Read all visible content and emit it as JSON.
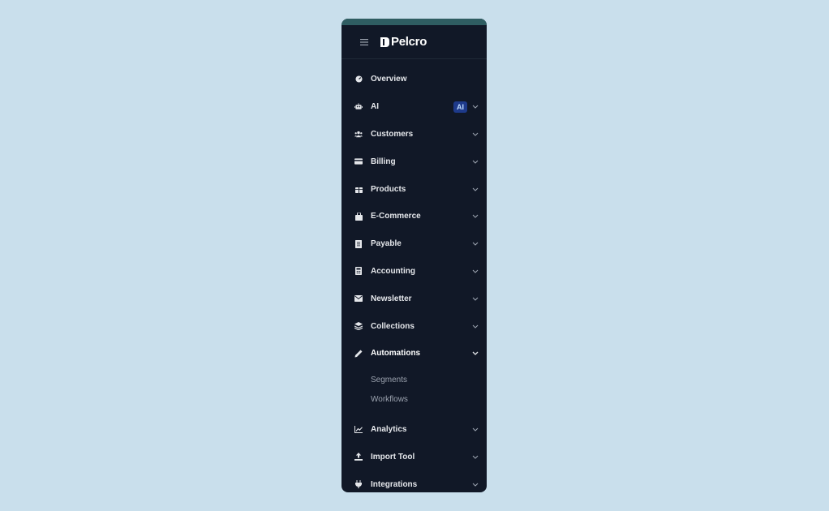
{
  "brand": {
    "name": "Pelcro"
  },
  "nav": {
    "overview": "Overview",
    "ai": "AI",
    "ai_badge": "AI",
    "customers": "Customers",
    "billing": "Billing",
    "products": "Products",
    "ecommerce": "E-Commerce",
    "payable": "Payable",
    "accounting": "Accounting",
    "newsletter": "Newsletter",
    "collections": "Collections",
    "automations": "Automations",
    "automations_sub": [
      "Segments",
      "Workflows"
    ],
    "analytics": "Analytics",
    "import_tool": "Import Tool",
    "integrations": "Integrations"
  },
  "colors": {
    "background": "#c9dfec",
    "sidebar": "#111827",
    "accent_bar": "#2f5d62",
    "badge_bg": "#1e3a8a"
  }
}
